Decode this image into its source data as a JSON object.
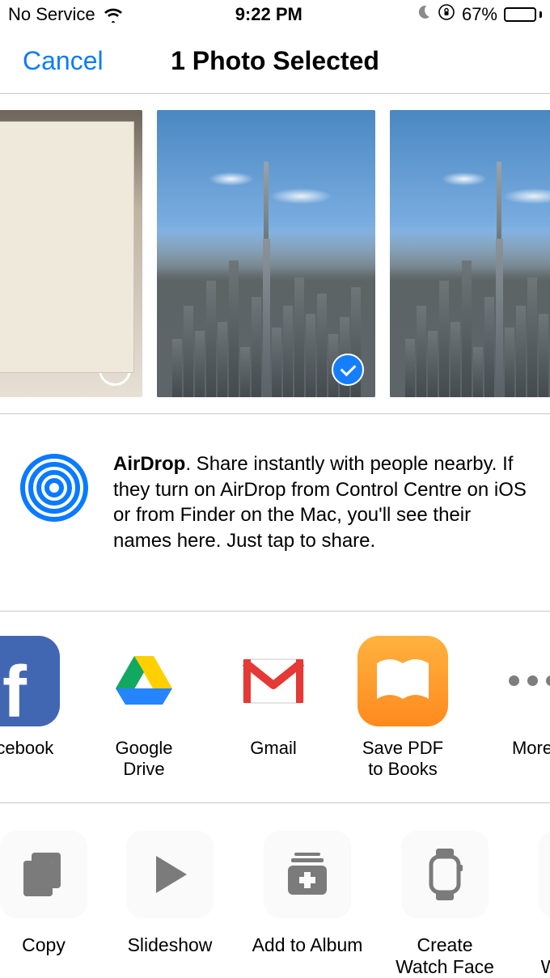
{
  "status": {
    "carrier": "No Service",
    "time": "9:22 PM",
    "battery_pct": "67%"
  },
  "nav": {
    "cancel": "Cancel",
    "title": "1 Photo Selected"
  },
  "photos": [
    {
      "selected": false
    },
    {
      "selected": true
    },
    {
      "selected": false
    }
  ],
  "airdrop": {
    "title": "AirDrop",
    "body": ". Share instantly with people nearby. If they turn on AirDrop from Control Centre on iOS or from Finder on the Mac, you'll see their names here. Just tap to share."
  },
  "apps": [
    {
      "label": "Facebook",
      "icon": "facebook"
    },
    {
      "label": "Google Drive",
      "icon": "drive"
    },
    {
      "label": "Gmail",
      "icon": "gmail"
    },
    {
      "label": "Save PDF\nto Books",
      "icon": "books"
    },
    {
      "label": "More",
      "icon": "more"
    }
  ],
  "actions": [
    {
      "label": "Copy",
      "icon": "copy"
    },
    {
      "label": "Slideshow",
      "icon": "play"
    },
    {
      "label": "Add to Album",
      "icon": "album"
    },
    {
      "label": "Create\nWatch Face",
      "icon": "watch"
    },
    {
      "label": "Use as\nWallpaper",
      "icon": "phone"
    }
  ]
}
